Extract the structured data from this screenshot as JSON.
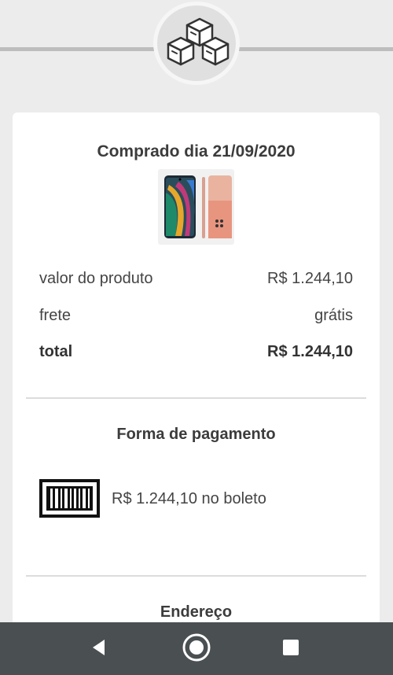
{
  "header": {
    "logo_icon": "boxes-icon"
  },
  "purchase": {
    "title": "Comprado dia 21/09/2020",
    "product_image": "smartphone-image",
    "rows": [
      {
        "label": "valor do produto",
        "value": "R$ 1.244,10"
      },
      {
        "label": "frete",
        "value": "grátis"
      },
      {
        "label": "total",
        "value": "R$ 1.244,10"
      }
    ]
  },
  "payment": {
    "title": "Forma de pagamento",
    "icon": "barcode-icon",
    "description": "R$ 1.244,10 no boleto"
  },
  "address": {
    "title": "Endereço"
  },
  "navbar": {
    "back_icon": "back-triangle-icon",
    "home_icon": "home-circle-icon",
    "recents_icon": "recents-square-icon",
    "color": "#4a4f52"
  }
}
